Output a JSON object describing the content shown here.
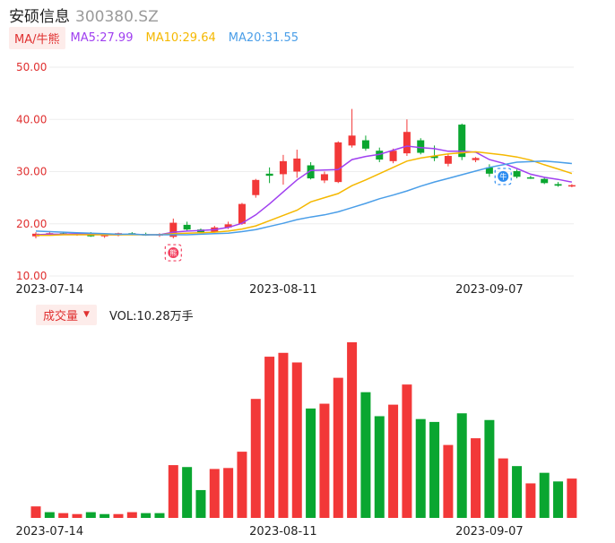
{
  "header": {
    "name": "安硕信息",
    "code": "300380.SZ"
  },
  "ma_legend": {
    "button": "MA/牛熊",
    "items": [
      {
        "label": "MA5:27.99",
        "color": "#a040f0"
      },
      {
        "label": "MA10:29.64",
        "color": "#f5b800"
      },
      {
        "label": "MA20:31.55",
        "color": "#4a9ee8"
      }
    ]
  },
  "volume_legend": {
    "button": "成交量",
    "value": "VOL:10.28万手"
  },
  "colors": {
    "up": "#f23838",
    "down": "#0aa630",
    "ma5": "#a040f0",
    "ma10": "#f5b800",
    "ma20": "#4a9ee8",
    "axis_text": "#e03030",
    "grid": "#eeeeee"
  },
  "markers": [
    {
      "index": 10,
      "icon": "bear-icon",
      "glyph": "熊",
      "color": "#f24060"
    },
    {
      "index": 34,
      "icon": "bull-icon",
      "glyph": "牛",
      "color": "#2d8cf0"
    }
  ],
  "chart_data": [
    {
      "type": "candlestick",
      "ylim": [
        10,
        50
      ],
      "yticks": [
        "10.00",
        "20.00",
        "30.00",
        "40.00",
        "50.00"
      ],
      "x_ticks": [
        {
          "index": 1,
          "label": "2023-07-14"
        },
        {
          "index": 18,
          "label": "2023-08-11"
        },
        {
          "index": 33,
          "label": "2023-09-07"
        }
      ],
      "candles": [
        {
          "o": 17.6,
          "h": 18.4,
          "l": 17.2,
          "c": 18.1
        },
        {
          "o": 18.1,
          "h": 18.6,
          "l": 17.8,
          "c": 18.2
        },
        {
          "o": 18.2,
          "h": 18.5,
          "l": 17.9,
          "c": 18.0
        },
        {
          "o": 18.0,
          "h": 18.3,
          "l": 17.7,
          "c": 18.1
        },
        {
          "o": 18.1,
          "h": 18.4,
          "l": 17.5,
          "c": 17.6
        },
        {
          "o": 17.6,
          "h": 18.0,
          "l": 17.3,
          "c": 17.9
        },
        {
          "o": 17.9,
          "h": 18.3,
          "l": 17.6,
          "c": 18.2
        },
        {
          "o": 18.2,
          "h": 18.4,
          "l": 17.8,
          "c": 18.0
        },
        {
          "o": 18.0,
          "h": 18.3,
          "l": 17.7,
          "c": 17.8
        },
        {
          "o": 17.8,
          "h": 18.2,
          "l": 17.5,
          "c": 18.0
        },
        {
          "o": 17.5,
          "h": 21.0,
          "l": 17.2,
          "c": 20.2
        },
        {
          "o": 19.8,
          "h": 20.4,
          "l": 18.6,
          "c": 18.9
        },
        {
          "o": 18.9,
          "h": 19.1,
          "l": 18.2,
          "c": 18.4
        },
        {
          "o": 18.4,
          "h": 19.6,
          "l": 18.3,
          "c": 19.3
        },
        {
          "o": 19.3,
          "h": 20.4,
          "l": 19.0,
          "c": 19.9
        },
        {
          "o": 20.0,
          "h": 24.0,
          "l": 19.8,
          "c": 23.8
        },
        {
          "o": 25.5,
          "h": 28.6,
          "l": 25.0,
          "c": 28.4
        },
        {
          "o": 29.6,
          "h": 30.8,
          "l": 27.8,
          "c": 29.2
        },
        {
          "o": 29.5,
          "h": 33.2,
          "l": 27.5,
          "c": 32.0
        },
        {
          "o": 30.0,
          "h": 34.2,
          "l": 28.8,
          "c": 32.5
        },
        {
          "o": 31.2,
          "h": 31.8,
          "l": 28.5,
          "c": 28.7
        },
        {
          "o": 28.3,
          "h": 30.0,
          "l": 27.8,
          "c": 29.5
        },
        {
          "o": 28.0,
          "h": 35.8,
          "l": 27.8,
          "c": 35.6
        },
        {
          "o": 35.0,
          "h": 42.0,
          "l": 34.6,
          "c": 36.9
        },
        {
          "o": 36.0,
          "h": 36.9,
          "l": 34.0,
          "c": 34.4
        },
        {
          "o": 34.0,
          "h": 34.6,
          "l": 31.8,
          "c": 32.3
        },
        {
          "o": 32.0,
          "h": 34.4,
          "l": 31.6,
          "c": 34.0
        },
        {
          "o": 33.5,
          "h": 40.0,
          "l": 33.0,
          "c": 37.6
        },
        {
          "o": 36.0,
          "h": 36.4,
          "l": 33.3,
          "c": 33.6
        },
        {
          "o": 33.0,
          "h": 35.0,
          "l": 32.0,
          "c": 32.6
        },
        {
          "o": 31.5,
          "h": 33.3,
          "l": 31.0,
          "c": 33.0
        },
        {
          "o": 39.0,
          "h": 39.2,
          "l": 32.2,
          "c": 32.8
        },
        {
          "o": 32.2,
          "h": 32.8,
          "l": 31.8,
          "c": 32.6
        },
        {
          "o": 30.8,
          "h": 31.4,
          "l": 29.0,
          "c": 29.6
        },
        {
          "o": 29.2,
          "h": 30.1,
          "l": 29.0,
          "c": 29.8
        },
        {
          "o": 30.1,
          "h": 30.4,
          "l": 28.7,
          "c": 29.0
        },
        {
          "o": 28.9,
          "h": 29.2,
          "l": 28.6,
          "c": 28.8
        },
        {
          "o": 28.6,
          "h": 29.0,
          "l": 27.6,
          "c": 27.8
        },
        {
          "o": 27.6,
          "h": 28.0,
          "l": 27.1,
          "c": 27.3
        },
        {
          "o": 27.3,
          "h": 27.6,
          "l": 27.0,
          "c": 27.4
        }
      ],
      "series": [
        {
          "key": "ma5",
          "values": [
            17.9,
            18.0,
            18.0,
            18.1,
            18.0,
            17.9,
            17.9,
            18.0,
            17.9,
            17.9,
            18.4,
            18.6,
            18.7,
            18.9,
            19.3,
            20.1,
            21.7,
            23.8,
            26.1,
            28.4,
            30.2,
            30.3,
            30.4,
            32.3,
            32.9,
            33.3,
            34.1,
            34.9,
            34.6,
            34.4,
            33.9,
            33.9,
            33.7,
            32.3,
            31.6,
            30.6,
            29.5,
            28.9,
            28.5,
            27.99
          ]
        },
        {
          "key": "ma10",
          "values": [
            17.8,
            17.8,
            17.9,
            17.9,
            17.9,
            17.9,
            17.9,
            17.9,
            17.9,
            17.9,
            18.1,
            18.2,
            18.3,
            18.4,
            18.6,
            19.0,
            19.6,
            20.6,
            21.6,
            22.6,
            24.2,
            25.0,
            25.8,
            27.3,
            28.4,
            29.6,
            30.8,
            32.0,
            32.6,
            33.0,
            33.4,
            33.6,
            33.8,
            33.5,
            33.2,
            32.8,
            32.2,
            31.3,
            30.5,
            29.64
          ]
        },
        {
          "key": "ma20",
          "values": [
            18.6,
            18.5,
            18.4,
            18.3,
            18.2,
            18.1,
            18.0,
            18.0,
            17.9,
            17.9,
            17.9,
            17.9,
            18.0,
            18.1,
            18.2,
            18.5,
            18.9,
            19.5,
            20.1,
            20.8,
            21.3,
            21.7,
            22.3,
            23.1,
            23.9,
            24.8,
            25.5,
            26.3,
            27.2,
            28.0,
            28.7,
            29.4,
            30.1,
            30.8,
            31.3,
            31.8,
            31.9,
            32.0,
            31.8,
            31.55
          ]
        }
      ]
    },
    {
      "type": "bar",
      "title": "成交量",
      "x_ticks": [
        {
          "index": 1,
          "label": "2023-07-14"
        },
        {
          "index": 18,
          "label": "2023-08-11"
        },
        {
          "index": 33,
          "label": "2023-09-07"
        }
      ],
      "values": [
        1.2,
        0.6,
        0.5,
        0.4,
        0.6,
        0.4,
        0.4,
        0.6,
        0.5,
        0.5,
        5.5,
        5.3,
        2.9,
        5.1,
        5.2,
        6.9,
        12.4,
        16.8,
        17.2,
        16.2,
        11.4,
        11.9,
        14.6,
        18.3,
        13.1,
        10.6,
        11.8,
        13.9,
        10.3,
        10.0,
        7.6,
        10.9,
        8.3,
        10.2,
        6.2,
        5.4,
        3.6,
        4.7,
        3.8,
        4.1
      ],
      "directions": [
        "up",
        "down",
        "up",
        "up",
        "down",
        "down",
        "up",
        "up",
        "down",
        "down",
        "up",
        "down",
        "down",
        "up",
        "up",
        "up",
        "up",
        "up",
        "up",
        "up",
        "down",
        "up",
        "up",
        "up",
        "down",
        "down",
        "up",
        "up",
        "down",
        "down",
        "up",
        "down",
        "up",
        "down",
        "up",
        "down",
        "up",
        "down",
        "down",
        "up"
      ]
    }
  ]
}
